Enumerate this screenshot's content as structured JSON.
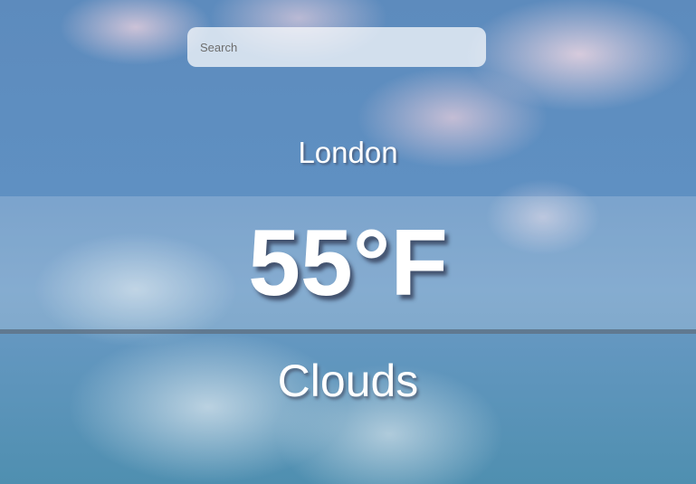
{
  "search": {
    "placeholder": "Search",
    "value": ""
  },
  "weather": {
    "city": "London",
    "temperature": "55°F",
    "condition": "Clouds"
  }
}
